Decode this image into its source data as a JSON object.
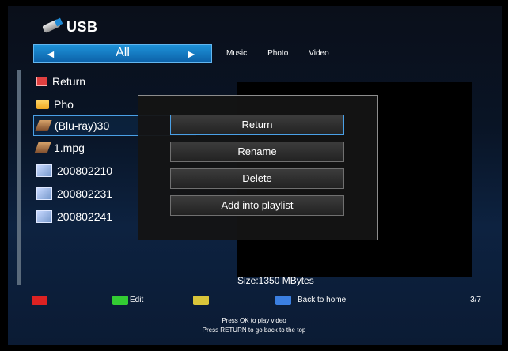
{
  "header": {
    "title": "USB",
    "icon": "usb-drive-icon"
  },
  "category_selector": {
    "current": "All",
    "left_arrow": "◄",
    "right_arrow": "►"
  },
  "tabs": [
    "Music",
    "Photo",
    "Video"
  ],
  "file_list": [
    {
      "label": "Return",
      "icon": "return-icon"
    },
    {
      "label": "Pho",
      "icon": "folder-icon"
    },
    {
      "label": "(Blu-ray)30",
      "icon": "video-file-icon",
      "selected": true
    },
    {
      "label": "1.mpg",
      "icon": "video-file-icon"
    },
    {
      "label": "200802210",
      "icon": "photo-file-icon"
    },
    {
      "label": "200802231",
      "icon": "photo-file-icon"
    },
    {
      "label": "200802241",
      "icon": "photo-file-icon"
    }
  ],
  "context_menu": {
    "items": [
      "Return",
      "Rename",
      "Delete",
      "Add into playlist"
    ],
    "active_index": 0
  },
  "size_text": "Size:1350 MBytes",
  "bottom_bar": {
    "edit_label": "Edit",
    "home_label": "Back to home",
    "page_indicator": "3/7"
  },
  "hints": {
    "line1": "Press OK to play video",
    "line2": "Press RETURN to go back to the top"
  },
  "colors": {
    "red_key": "#dd2222",
    "green_key": "#33cc33",
    "yellow_key": "#d9c53a",
    "blue_key": "#3b7fe1",
    "accent": "#1e92d8"
  }
}
